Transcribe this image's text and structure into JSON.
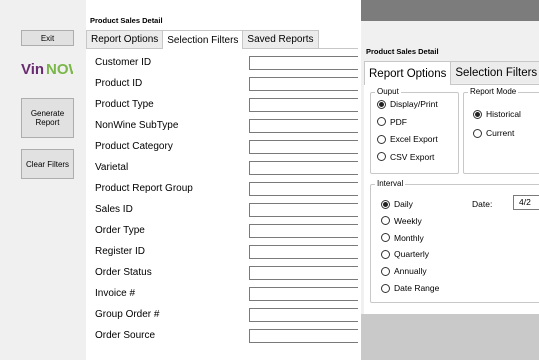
{
  "left": {
    "sidebar": {
      "exit_label": "Exit",
      "generate_label": "Generate\nReport",
      "clear_label": "Clear Filters",
      "logo_text": "VinNOW"
    },
    "title": "Product Sales Detail",
    "tabs": [
      "Report Options",
      "Selection Filters",
      "Saved Reports"
    ],
    "active_tab": "Selection Filters",
    "filters": [
      {
        "label": "Customer ID",
        "value": ""
      },
      {
        "label": "Product ID",
        "value": ""
      },
      {
        "label": "Product Type",
        "value": ""
      },
      {
        "label": "NonWine SubType",
        "value": ""
      },
      {
        "label": "Product Category",
        "value": ""
      },
      {
        "label": "Varietal",
        "value": ""
      },
      {
        "label": "Product Report Group",
        "value": ""
      },
      {
        "label": "Sales ID",
        "value": ""
      },
      {
        "label": "Order Type",
        "value": ""
      },
      {
        "label": "Register ID",
        "value": ""
      },
      {
        "label": "Order Status",
        "value": ""
      },
      {
        "label": "Invoice #",
        "value": ""
      },
      {
        "label": "Group Order #",
        "value": ""
      },
      {
        "label": "Order Source",
        "value": ""
      }
    ]
  },
  "right": {
    "title": "Product Sales Detail",
    "tabs": [
      "Report Options",
      "Selection Filters"
    ],
    "active_tab": "Report Options",
    "output": {
      "legend": "Ouput",
      "options": [
        "Display/Print",
        "PDF",
        "Excel Export",
        "CSV Export"
      ],
      "selected": "Display/Print"
    },
    "mode": {
      "legend": "Report Mode",
      "options": [
        "Historical",
        "Current"
      ],
      "selected": "Historical"
    },
    "interval": {
      "legend": "Interval",
      "options": [
        "Daily",
        "Weekly",
        "Monthly",
        "Quarterly",
        "Annually",
        "Date Range"
      ],
      "selected": "Daily",
      "date_label": "Date:",
      "date_value": "4/2"
    }
  },
  "colors": {
    "logo_green": "#7ab648",
    "logo_purple": "#6a2c70",
    "panel_gray": "#f0f0f0",
    "titlebar_gray": "#7c7c7c"
  }
}
